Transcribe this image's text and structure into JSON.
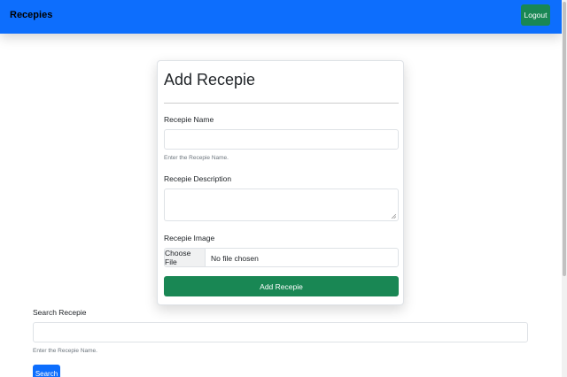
{
  "navbar": {
    "brand": "Recepies",
    "logout_label": "Logout",
    "color": "#0d6efd"
  },
  "add_form": {
    "title": "Add Recepie",
    "name_label": "Recepie Name",
    "name_value": "",
    "name_help": "Enter the Recepie Name.",
    "description_label": "Recepie Description",
    "description_value": "",
    "image_label": "Recepie Image",
    "file_button_label": "Choose File",
    "file_status": "No file chosen",
    "submit_label": "Add Recepie",
    "submit_color": "#198754"
  },
  "search": {
    "label": "Search Recepie",
    "value": "",
    "help": "Enter the Recepie Name.",
    "button_label": "Search",
    "button_color": "#0d6efd"
  }
}
